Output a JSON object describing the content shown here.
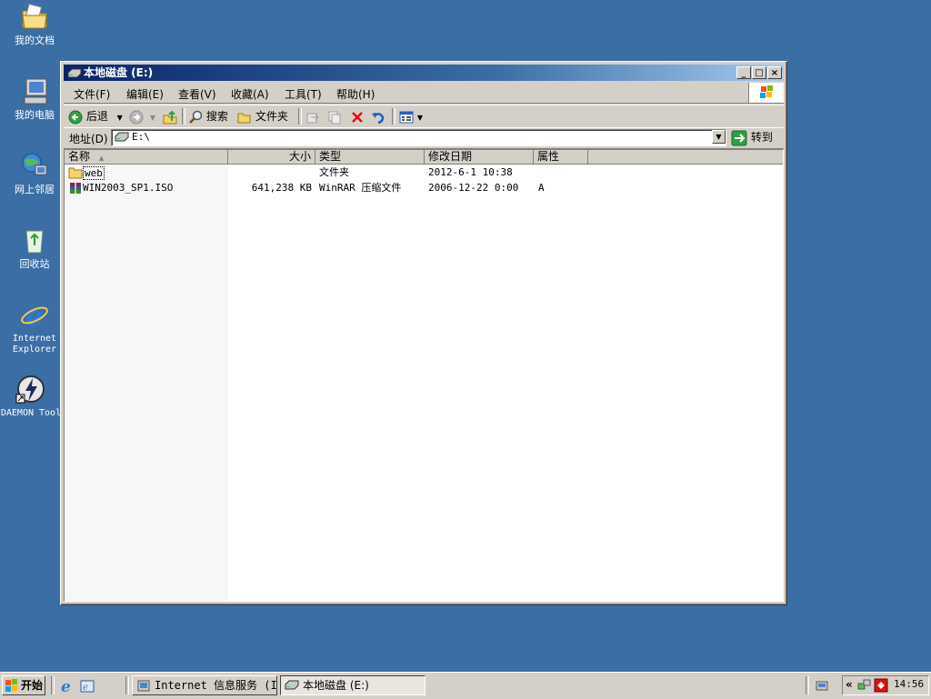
{
  "desktop": {
    "icons": [
      {
        "label": "我的文档",
        "icon": "my-documents-icon"
      },
      {
        "label": "我的电脑",
        "icon": "my-computer-icon"
      },
      {
        "label": "网上邻居",
        "icon": "network-places-icon"
      },
      {
        "label": "回收站",
        "icon": "recycle-bin-icon"
      },
      {
        "label": "Internet Explorer",
        "icon": "ie-icon"
      },
      {
        "label": "DAEMON Tool",
        "icon": "daemon-tools-icon"
      }
    ]
  },
  "window": {
    "title": "本地磁盘 (E:)",
    "controls": {
      "minimize": "_",
      "maximize": "□",
      "close": "×"
    },
    "menu": [
      "文件(F)",
      "编辑(E)",
      "查看(V)",
      "收藏(A)",
      "工具(T)",
      "帮助(H)"
    ],
    "toolbar": {
      "back": "后退",
      "search": "搜索",
      "folders": "文件夹"
    },
    "address": {
      "label": "地址(D)",
      "value": "E:\\",
      "go": "转到"
    },
    "columns": [
      "名称",
      "大小",
      "类型",
      "修改日期",
      "属性"
    ],
    "files": [
      {
        "name": "web",
        "size": "",
        "type": "文件夹",
        "modified": "2012-6-1 10:38",
        "attr": "",
        "icon": "folder-icon"
      },
      {
        "name": "WIN2003_SP1.ISO",
        "size": "641,238 KB",
        "type": "WinRAR 压缩文件",
        "modified": "2006-12-22 0:00",
        "attr": "A",
        "icon": "winrar-archive-icon"
      }
    ]
  },
  "taskbar": {
    "start": "开始",
    "tasks": [
      {
        "label": "Internet 信息服务 (I...",
        "active": false
      },
      {
        "label": "本地磁盘 (E:)",
        "active": true
      }
    ],
    "tray": {
      "collapse": "«",
      "clock": "14:56"
    }
  },
  "colors": {
    "desktop": "#3a6ea5",
    "titlebar_start": "#0a246a",
    "titlebar_end": "#a6caf0",
    "face": "#d4d0c8"
  }
}
